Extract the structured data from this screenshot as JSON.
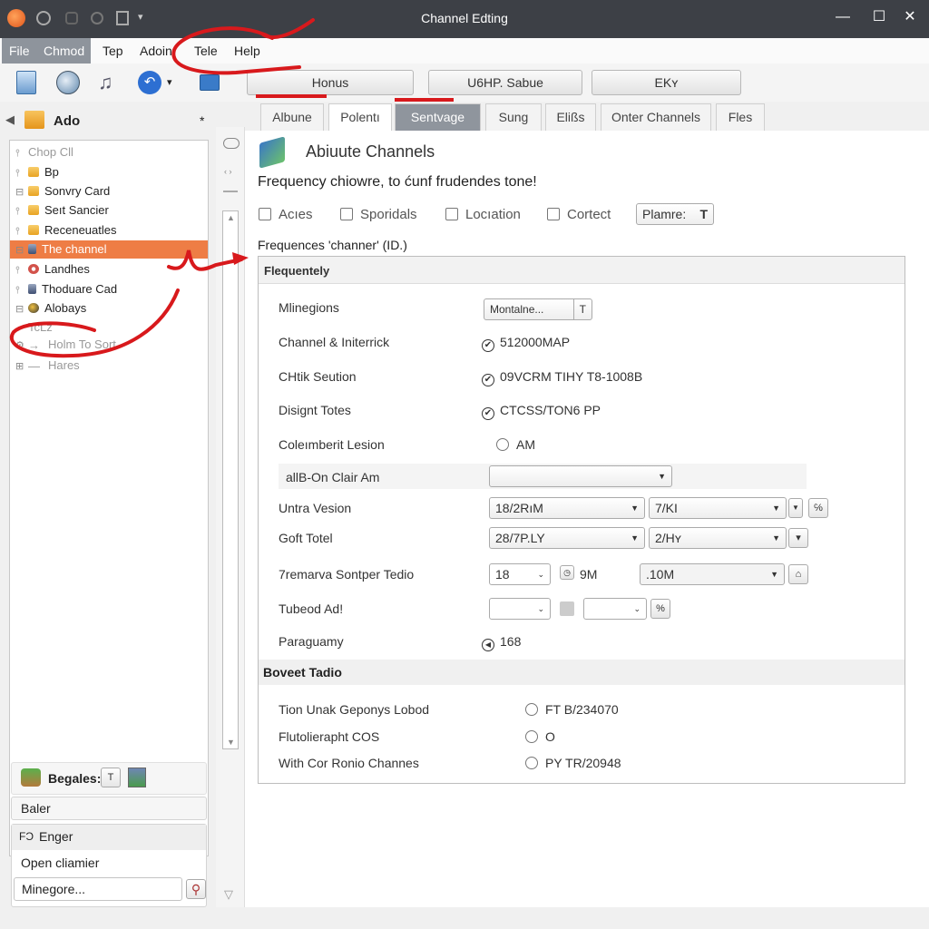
{
  "window": {
    "title": "Channel Edting",
    "controls": {
      "minimize": "—",
      "maximize": "☐",
      "close": "✕"
    }
  },
  "menubar": {
    "items": [
      {
        "label": "File",
        "active": true
      },
      {
        "label": "Chmod",
        "active": true
      },
      {
        "label": "Tep"
      },
      {
        "label": "Adoin"
      },
      {
        "label": "Tele"
      },
      {
        "label": "Help"
      }
    ]
  },
  "toolbar": {
    "buttons": [
      {
        "label": "Honus"
      },
      {
        "label": "U6HP. Sabue"
      },
      {
        "label": "EKʏ"
      }
    ],
    "dropdown_glyph": "▾"
  },
  "tabs": [
    {
      "label": "Albune",
      "state": "normal"
    },
    {
      "label": "Polentı",
      "state": "active"
    },
    {
      "label": "Sentvage",
      "state": "highlighted"
    },
    {
      "label": "Sung",
      "state": "normal"
    },
    {
      "label": "Elißs",
      "state": "normal"
    },
    {
      "label": "Onter Channels",
      "state": "normal"
    },
    {
      "label": "Fles",
      "state": "normal"
    }
  ],
  "left_panel": {
    "header": {
      "title": "Ado",
      "pin": "*",
      "back": "◀"
    },
    "tree": [
      {
        "label": "Chop Cll",
        "exp": "⫯",
        "icon": "none",
        "dim": true
      },
      {
        "label": "Bp",
        "exp": "⫯",
        "icon": "folder"
      },
      {
        "label": "Sonvry Card",
        "exp": "⊟",
        "icon": "folder"
      },
      {
        "label": "Seıt Sancier",
        "exp": "⫯",
        "icon": "folder"
      },
      {
        "label": "Receneuatles",
        "exp": "⫯",
        "icon": "folder"
      },
      {
        "label": "The channel",
        "exp": "⊟",
        "icon": "device",
        "selected": true
      },
      {
        "label": "Landhes",
        "exp": "⫯",
        "icon": "gear"
      },
      {
        "label": "Thoduare Cad",
        "exp": "⫯",
        "icon": "device"
      },
      {
        "label": "Alobays",
        "exp": "⊟",
        "icon": "globe"
      },
      {
        "label": "TcLz",
        "exp": "",
        "icon": "none",
        "dim": true
      },
      {
        "label": "Holm To Sort",
        "exp": "⚙",
        "icon": "arrow",
        "dim": true
      },
      {
        "label": "Hares",
        "exp": "⊞",
        "icon": "dash",
        "dim": true
      }
    ],
    "bottom": {
      "group_label": "Begales:",
      "baler": "Baler",
      "enger": "Enger",
      "enger_prefix": "FƆ",
      "open_claimer": "Open cliamier",
      "search_value": "Minegore...",
      "search_icon_glyph": "⚲"
    }
  },
  "content": {
    "heading": "Abiuute Channels",
    "subheading": "Frequency chiowre, to ćunf frudendes tone!",
    "filters": [
      {
        "label": "Acıes",
        "checked": false
      },
      {
        "label": "Sporidals",
        "checked": false
      },
      {
        "label": "Locıation",
        "checked": false
      },
      {
        "label": "Cortect",
        "checked": false
      }
    ],
    "filter_dropdown": {
      "value": "Plamre:",
      "btn": "T"
    },
    "group_label": "Frequences 'channer' (ID.)",
    "section1": {
      "title": "Flequentely",
      "rows": [
        {
          "label": "Mlinegions",
          "type": "button-select",
          "value": "Montalne...",
          "btn": "T"
        },
        {
          "label": "Channel & Initerrick",
          "type": "check",
          "value": "512000MAP"
        },
        {
          "label": "CHtik Seution",
          "type": "check",
          "value": "09VCRM TIHY T8-1008B"
        },
        {
          "label": "Disignt Totes",
          "type": "check",
          "value": "CTCSS/TON6 PP"
        },
        {
          "label": "Coleımberit Lesion",
          "type": "radio",
          "value": "AM"
        },
        {
          "label": "allB-On Clair Am",
          "type": "select",
          "value": ""
        },
        {
          "label": "Untra Vesion",
          "type": "double-select",
          "value1": "18/2RıM",
          "value2": "7/KI",
          "btn": "℅"
        },
        {
          "label": "Goft Totel",
          "type": "double-select",
          "value1": "28/7P.LY",
          "value2": "2/Hʏ",
          "btn": "▾"
        },
        {
          "label": "7remarva Sontper Tedio",
          "type": "mixed",
          "value1": "18",
          "value2": "9M",
          "value3": ".10M",
          "btn": "⌂"
        },
        {
          "label": "Tubeod Ad!",
          "type": "empty-selects",
          "btn": "%"
        },
        {
          "label": "Paraguamy",
          "type": "icon-value",
          "value": "168"
        }
      ]
    },
    "section2": {
      "title": "Boveet Tadio",
      "rows": [
        {
          "label": "Tion Unak Geponys Lobod",
          "value": "FT B/234070"
        },
        {
          "label": "Flutolierapht COS",
          "value": "O"
        },
        {
          "label": "With Cor Ronio Channes",
          "value": "PY TR/20948"
        }
      ]
    }
  },
  "colors": {
    "titlebar": "#3d4046",
    "selection": "#ee7d45",
    "tab_highlight": "#8f959d",
    "annotation_red": "#d8191c"
  }
}
